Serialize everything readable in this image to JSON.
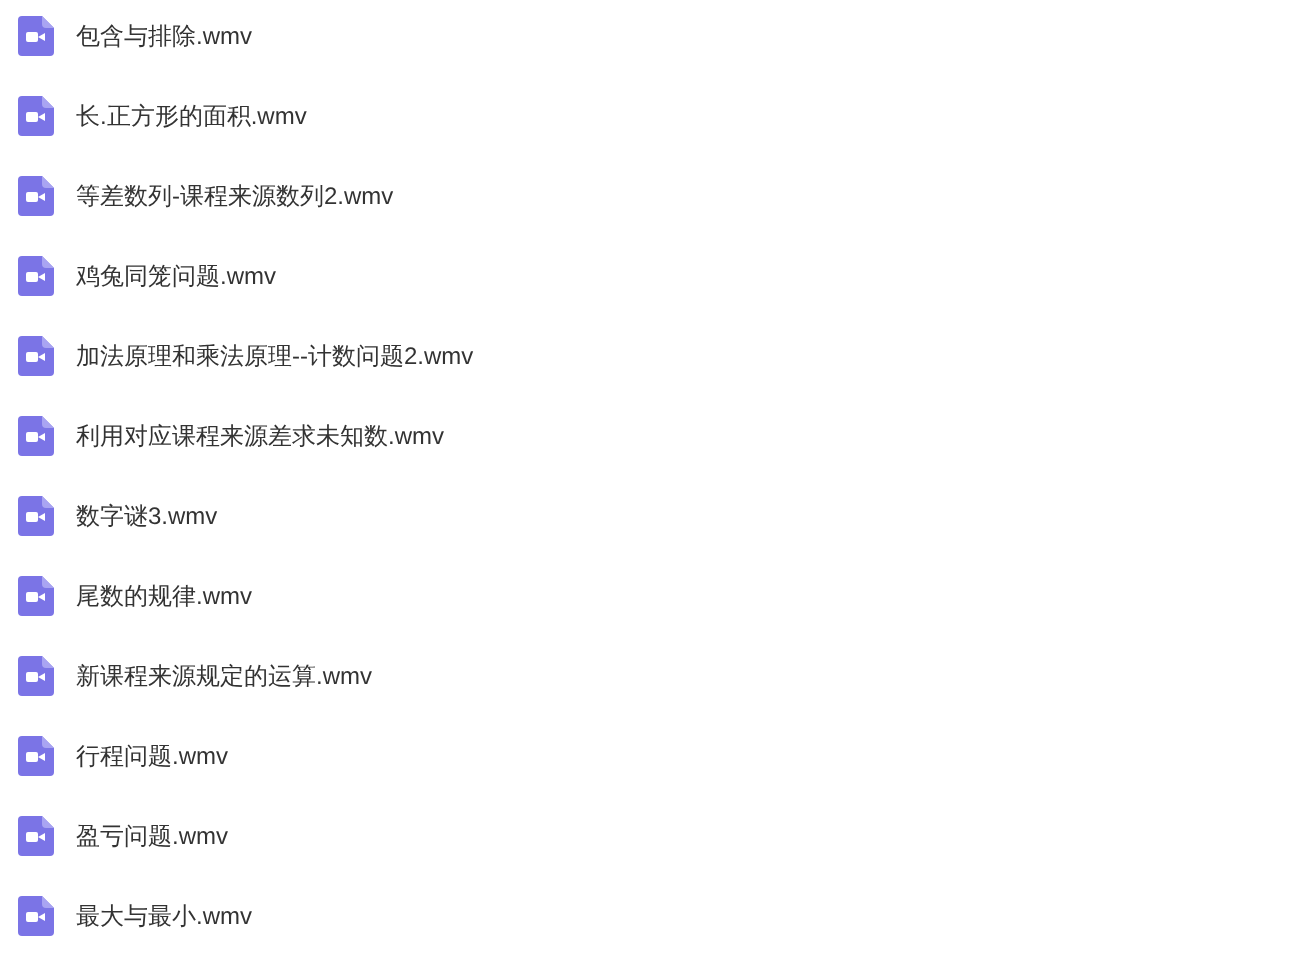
{
  "files": [
    {
      "name": "包含与排除.wmv"
    },
    {
      "name": "长.正方形的面积.wmv"
    },
    {
      "name": "等差数列-课程来源数列2.wmv"
    },
    {
      "name": "鸡兔同笼问题.wmv"
    },
    {
      "name": "加法原理和乘法原理--计数问题2.wmv"
    },
    {
      "name": "利用对应课程来源差求未知数.wmv"
    },
    {
      "name": "数字谜3.wmv"
    },
    {
      "name": "尾数的规律.wmv"
    },
    {
      "name": "新课程来源规定的运算.wmv"
    },
    {
      "name": "行程问题.wmv"
    },
    {
      "name": "盈亏问题.wmv"
    },
    {
      "name": "最大与最小.wmv"
    }
  ]
}
